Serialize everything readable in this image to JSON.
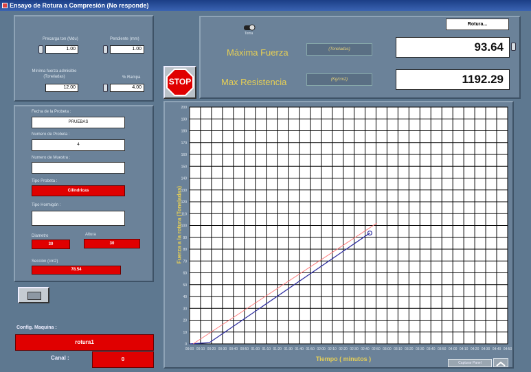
{
  "window": {
    "title": "Ensayo de Rotura a Compresión (No responde)"
  },
  "params": {
    "precarga_label": "Precarga ton (Mdu)",
    "precarga_value": "1.00",
    "pendiente_label": "Pendiente (mm)",
    "pendiente_value": "1.00",
    "minfuerza_label": "Mínima fuerza admisible (Toneladas)",
    "minfuerza_value": "12.00",
    "pctrampa_label": "% Rampa",
    "pctrampa_value": "4.00"
  },
  "probeta": {
    "fecha_label": "Fecha de la Probeta :",
    "fecha_value": "PRUEBAS",
    "numero_label": "Numero de Probeta :",
    "numero_value": "4",
    "muestra_label": "Numero de Muestra :",
    "muestra_value": "",
    "tipo_label": "Tipo Probeta :",
    "tipo_value": "Cilíndricas",
    "hormigon_label": "Tipo Hormigón :",
    "hormigon_value": "",
    "diametro_label": "Diametro",
    "diametro_value": "30",
    "altura_label": "Altura",
    "altura_value": "30",
    "seccion_label": "Sección (cm2)",
    "seccion_value": "78.54"
  },
  "config": {
    "label": "Config. Maquina :",
    "value": "rotura1",
    "canal_label": "Canal :",
    "canal_value": "0"
  },
  "controls": {
    "stop_label": "STOP",
    "rotura_button": "Rotura...",
    "toggle_caption": "Toma",
    "corner_button": "Capturar Panel"
  },
  "results": {
    "max_fuerza_label": "Máxima Fuerza",
    "max_fuerza_unit": "(Toneladas)",
    "max_fuerza_value": "93.64",
    "max_res_label": "Max Resistencia",
    "max_res_unit": "(Kg/cm2)",
    "max_res_value": "1192.29"
  },
  "colors": {
    "accent_red": "#e00000",
    "label_yellow": "#e6cf55",
    "plot_bg": "#ffffff",
    "grid": "#000000"
  },
  "chart_data": {
    "type": "line",
    "xlabel": "Tiempo ( minutos )",
    "ylabel": "Fuerza a la rotura (Toneladas)",
    "xlim": [
      0,
      4.5
    ],
    "ylim": [
      0,
      200
    ],
    "x_ticks": [
      "00:00",
      "00:10",
      "00:20",
      "00:30",
      "00:40",
      "00:50",
      "01:00",
      "01:10",
      "01:20",
      "01:30",
      "01:40",
      "01:50",
      "02:00",
      "02:10",
      "02:20",
      "02:30",
      "02:40",
      "02:50",
      "03:00",
      "03:10",
      "03:20",
      "03:30",
      "03:40",
      "03:50",
      "04:00",
      "04:10",
      "04:20",
      "04:30",
      "04:40",
      "04:50"
    ],
    "y_ticks": [
      0,
      10,
      20,
      30,
      40,
      50,
      60,
      70,
      80,
      90,
      100,
      110,
      120,
      130,
      140,
      150,
      160,
      170,
      180,
      190,
      200
    ],
    "series": [
      {
        "color": "#3030a0",
        "x": [
          0,
          0.28,
          2.55
        ],
        "y": [
          0,
          1,
          93.6
        ]
      },
      {
        "color": "#ff7b7b",
        "x": [
          0.05,
          2.65
        ],
        "y": [
          0,
          102
        ]
      }
    ],
    "peak_marker": {
      "x": 2.55,
      "y": 93.6
    },
    "grid": true
  }
}
